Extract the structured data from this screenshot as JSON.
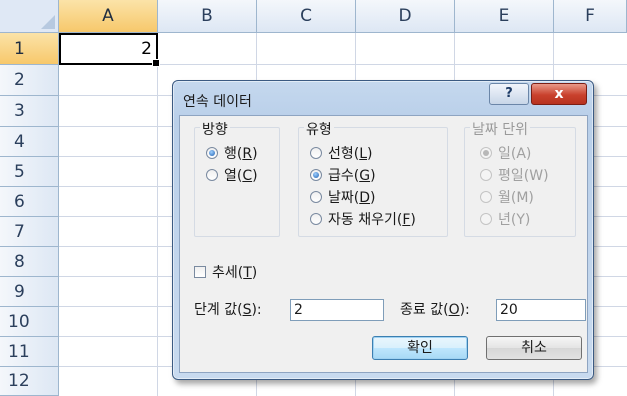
{
  "sheet": {
    "columns": [
      "A",
      "B",
      "C",
      "D",
      "E",
      "F"
    ],
    "rows": [
      "1",
      "2",
      "3",
      "4",
      "5",
      "6",
      "7",
      "8",
      "9",
      "10",
      "11",
      "12"
    ],
    "cell_a1_value": "2"
  },
  "dialog": {
    "title": "연속 데이터",
    "help_label": "?",
    "close_label": "x",
    "direction": {
      "label": "방향",
      "options": [
        {
          "label": "행(",
          "key": "R",
          "suffix": ")",
          "selected": true
        },
        {
          "label": "열(",
          "key": "C",
          "suffix": ")",
          "selected": false
        }
      ]
    },
    "type": {
      "label": "유형",
      "options": [
        {
          "label": "선형(",
          "key": "L",
          "suffix": ")",
          "selected": false
        },
        {
          "label": "급수(",
          "key": "G",
          "suffix": ")",
          "selected": true
        },
        {
          "label": "날짜(",
          "key": "D",
          "suffix": ")",
          "selected": false
        },
        {
          "label": "자동 채우기(",
          "key": "F",
          "suffix": ")",
          "selected": false
        }
      ]
    },
    "date_unit": {
      "label": "날짜 단위",
      "options": [
        {
          "label": "일(A)",
          "selected": true
        },
        {
          "label": "평일(W)",
          "selected": false
        },
        {
          "label": "월(M)",
          "selected": false
        },
        {
          "label": "년(Y)",
          "selected": false
        }
      ]
    },
    "trend": {
      "label": "추세(",
      "key": "T",
      "suffix": ")",
      "checked": false
    },
    "step": {
      "label": "단계 값(",
      "key": "S",
      "suffix": "):",
      "value": "2"
    },
    "stop": {
      "label": "종료 값(",
      "key": "O",
      "suffix": "):",
      "value": "20"
    },
    "ok_label": "확인",
    "cancel_label": "취소"
  },
  "colors": {
    "header_selected": "#f7c86b",
    "dialog_frame": "#b9cfe9",
    "close_button": "#c9412d"
  }
}
